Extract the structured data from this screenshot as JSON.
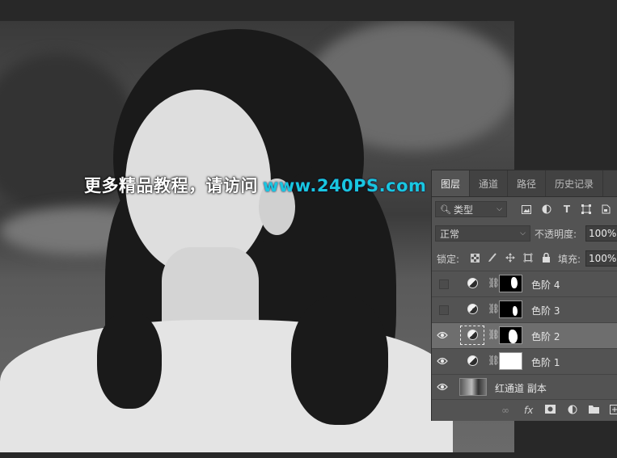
{
  "canvas": {
    "watermark_cn": "更多精品教程，请访问",
    "watermark_url": "www.240PS.com"
  },
  "layers_panel": {
    "tabs": [
      "图层",
      "通道",
      "路径",
      "历史记录"
    ],
    "active_tab": "图层",
    "filter_select": "类型",
    "blend_mode": "正常",
    "opacity_label": "不透明度:",
    "opacity_value": "100%",
    "lock_label": "锁定:",
    "fill_label": "填充:",
    "fill_value": "100%",
    "layers": [
      {
        "name": "色阶 4",
        "visible": false,
        "selected": false
      },
      {
        "name": "色阶 3",
        "visible": false,
        "selected": false
      },
      {
        "name": "色阶 2",
        "visible": true,
        "selected": true
      },
      {
        "name": "色阶 1",
        "visible": true,
        "selected": false
      },
      {
        "name": "红通道 副本",
        "visible": true,
        "selected": false
      }
    ],
    "fx_label": "fx"
  },
  "colors": {
    "accent_url": "#19c6e0",
    "panel_bg": "#535353",
    "selected_row": "#6e6e6e"
  }
}
